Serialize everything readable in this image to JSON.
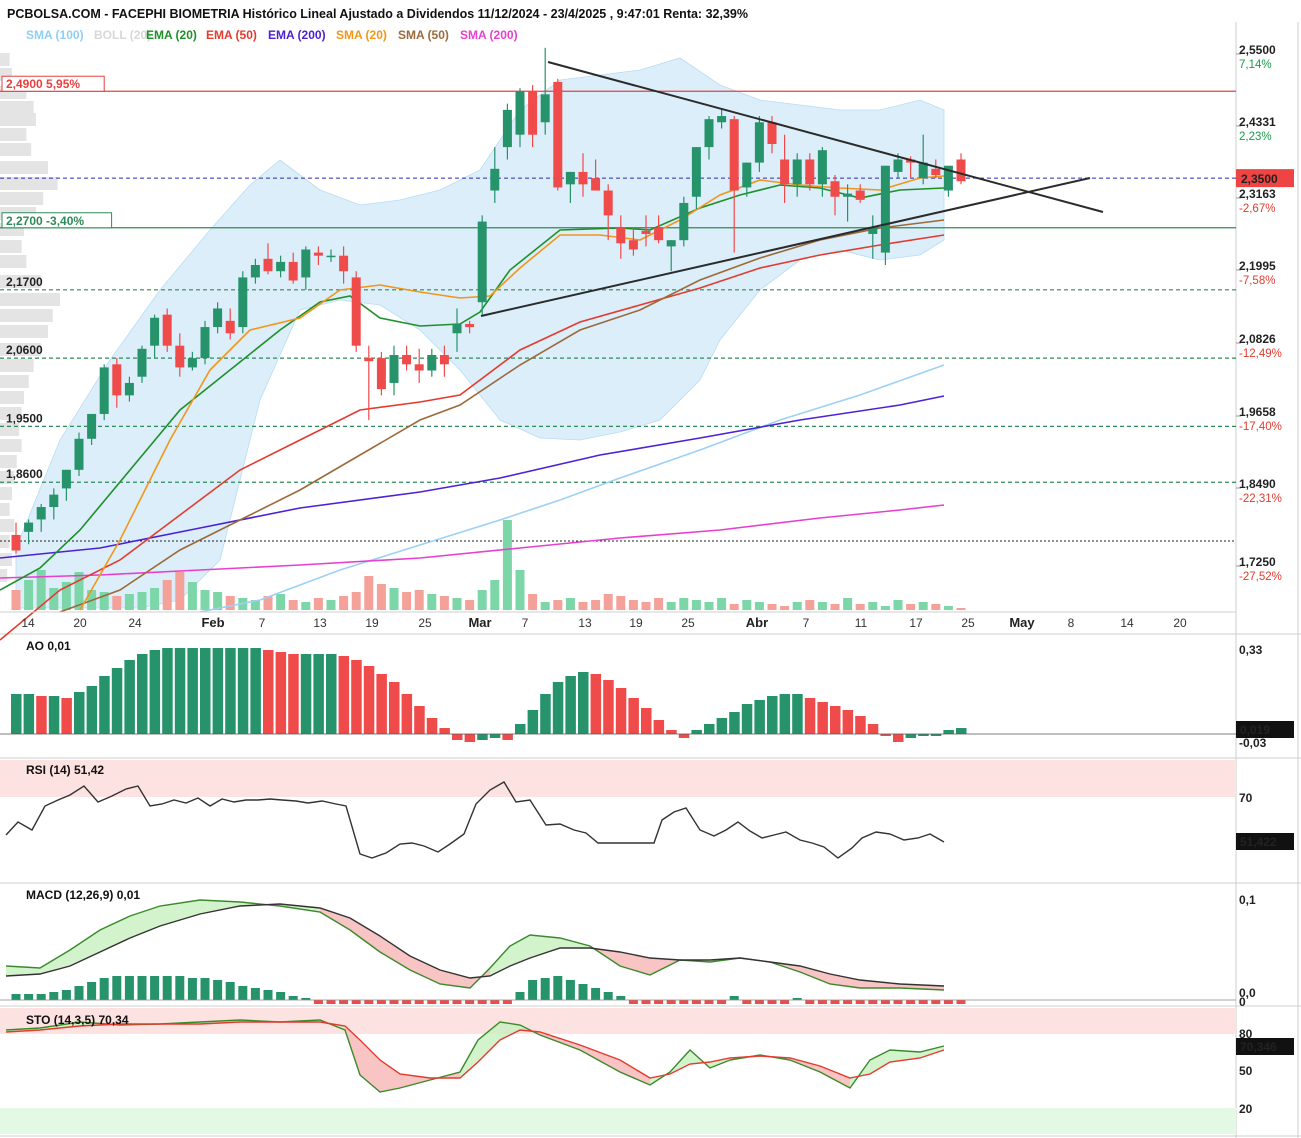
{
  "header": {
    "title": "PCBOLSA.COM - FACEPHI BIOMETRIA Histórico Lineal Ajustado a Dividendos 11/12/2024 - 23/4/2025 , 9:47:01 Renta: 32,39%"
  },
  "legend": [
    {
      "label": "SMA (100)",
      "color": "#8fcff5"
    },
    {
      "label": "BOLL (20)",
      "color": "#d8d8d8"
    },
    {
      "label": "EMA (20)",
      "color": "#1f8f2a"
    },
    {
      "label": "EMA (50)",
      "color": "#e33b2e"
    },
    {
      "label": "EMA (200)",
      "color": "#4b22d6"
    },
    {
      "label": "SMA (20)",
      "color": "#f2961a"
    },
    {
      "label": "SMA (50)",
      "color": "#9c6a3a"
    },
    {
      "label": "SMA (200)",
      "color": "#e83fd0"
    }
  ],
  "price_axis": {
    "ticks": [
      {
        "value": "2,5500",
        "pct": "7,14%",
        "pct_color": "#1a9a4a"
      },
      {
        "value": "2,4331",
        "pct": "2,23%",
        "pct_color": "#1a9a4a"
      },
      {
        "value": "2,3163",
        "pct": "-2,67%",
        "pct_color": "#e33b2e"
      },
      {
        "value": "2,1995",
        "pct": "-7,58%",
        "pct_color": "#e33b2e"
      },
      {
        "value": "2,0826",
        "pct": "-12,49%",
        "pct_color": "#e33b2e"
      },
      {
        "value": "1,9658",
        "pct": "-17,40%",
        "pct_color": "#e33b2e"
      },
      {
        "value": "1,8490",
        "pct": "-22,31%",
        "pct_color": "#e33b2e"
      },
      {
        "value": "1,7250",
        "pct": "-27,52%",
        "pct_color": "#e33b2e"
      }
    ],
    "current_price": "2,3500"
  },
  "levels": [
    {
      "label": "2,4900  5,95%",
      "price": 2.49,
      "color": "#e84040",
      "style": "solid",
      "boxed": true
    },
    {
      "label": "2,2700  -3,40%",
      "price": 2.27,
      "color": "#2e8b57",
      "style": "solid",
      "boxed": true
    },
    {
      "label": "2,1700",
      "price": 2.17,
      "color": "#2e8b57",
      "style": "dashed"
    },
    {
      "label": "2,0600",
      "price": 2.06,
      "color": "#2e8b57",
      "style": "dashed"
    },
    {
      "label": "1,9500",
      "price": 1.95,
      "color": "#2e8b57",
      "style": "dashed"
    },
    {
      "label": "1,8600",
      "price": 1.86,
      "color": "#2e8b57",
      "style": "dashed"
    }
  ],
  "x_axis": {
    "labels": [
      {
        "text": "14",
        "bold": false
      },
      {
        "text": "20",
        "bold": false
      },
      {
        "text": "24",
        "bold": false
      },
      {
        "text": "Feb",
        "bold": true
      },
      {
        "text": "7",
        "bold": false
      },
      {
        "text": "13",
        "bold": false
      },
      {
        "text": "19",
        "bold": false
      },
      {
        "text": "25",
        "bold": false
      },
      {
        "text": "Mar",
        "bold": true
      },
      {
        "text": "7",
        "bold": false
      },
      {
        "text": "13",
        "bold": false
      },
      {
        "text": "19",
        "bold": false
      },
      {
        "text": "25",
        "bold": false
      },
      {
        "text": "Abr",
        "bold": true
      },
      {
        "text": "7",
        "bold": false
      },
      {
        "text": "11",
        "bold": false
      },
      {
        "text": "17",
        "bold": false
      },
      {
        "text": "25",
        "bold": false
      },
      {
        "text": "May",
        "bold": true
      },
      {
        "text": "8",
        "bold": false
      },
      {
        "text": "14",
        "bold": false
      },
      {
        "text": "20",
        "bold": false
      }
    ]
  },
  "panels": {
    "ao": {
      "label": "AO",
      "value": "0,01",
      "ticks": [
        "0,33",
        "-0,03"
      ],
      "current": "0,019"
    },
    "rsi": {
      "label": "RSI (14)",
      "value": "51,42",
      "ticks": [
        "70"
      ],
      "current": "51,422"
    },
    "macd": {
      "label": "MACD (12,26,9)",
      "value": "0,01",
      "ticks": [
        "0,1",
        "0,0",
        "0"
      ]
    },
    "sto": {
      "label": "STO (14,3,5)",
      "value": "70,34",
      "ticks": [
        "80",
        "50",
        "20"
      ],
      "current": "70,346"
    }
  },
  "chart_data": {
    "type": "candlestick",
    "title": "PCBOLSA.COM - FACEPHI BIOMETRIA Histórico Lineal Ajustado a Dividendos 11/12/2024 - 23/4/2025 , 9:47:01 Renta: 32,39%",
    "ylim": [
      1.7,
      2.58
    ],
    "ohlc": [
      [
        1.775,
        1.795,
        1.745,
        1.75
      ],
      [
        1.78,
        1.8,
        1.76,
        1.795
      ],
      [
        1.8,
        1.825,
        1.78,
        1.82
      ],
      [
        1.82,
        1.85,
        1.8,
        1.84
      ],
      [
        1.85,
        1.88,
        1.83,
        1.88
      ],
      [
        1.88,
        1.94,
        1.87,
        1.93
      ],
      [
        1.93,
        1.97,
        1.92,
        1.97
      ],
      [
        1.97,
        2.05,
        1.96,
        2.045
      ],
      [
        2.05,
        2.06,
        1.98,
        2.0
      ],
      [
        2.0,
        2.03,
        1.99,
        2.02
      ],
      [
        2.03,
        2.08,
        2.02,
        2.075
      ],
      [
        2.08,
        2.13,
        2.06,
        2.125
      ],
      [
        2.13,
        2.14,
        2.07,
        2.08
      ],
      [
        2.08,
        2.1,
        2.03,
        2.045
      ],
      [
        2.045,
        2.07,
        2.04,
        2.06
      ],
      [
        2.06,
        2.12,
        2.05,
        2.11
      ],
      [
        2.11,
        2.15,
        2.1,
        2.14
      ],
      [
        2.12,
        2.14,
        2.09,
        2.1
      ],
      [
        2.11,
        2.2,
        2.1,
        2.19
      ],
      [
        2.19,
        2.22,
        2.18,
        2.21
      ],
      [
        2.22,
        2.245,
        2.195,
        2.2
      ],
      [
        2.2,
        2.225,
        2.19,
        2.215
      ],
      [
        2.215,
        2.23,
        2.18,
        2.185
      ],
      [
        2.19,
        2.24,
        2.17,
        2.235
      ],
      [
        2.23,
        2.24,
        2.21,
        2.225
      ],
      [
        2.225,
        2.235,
        2.215,
        2.225
      ],
      [
        2.225,
        2.24,
        2.18,
        2.2
      ],
      [
        2.19,
        2.2,
        2.07,
        2.08
      ],
      [
        2.06,
        2.08,
        1.96,
        2.055
      ],
      [
        2.06,
        2.07,
        2.0,
        2.01
      ],
      [
        2.02,
        2.08,
        2.0,
        2.065
      ],
      [
        2.065,
        2.08,
        2.04,
        2.05
      ],
      [
        2.05,
        2.075,
        2.02,
        2.04
      ],
      [
        2.04,
        2.075,
        2.03,
        2.065
      ],
      [
        2.065,
        2.08,
        2.03,
        2.05
      ],
      [
        2.1,
        2.14,
        2.07,
        2.115
      ],
      [
        2.115,
        2.12,
        2.1,
        2.11
      ],
      [
        2.15,
        2.29,
        2.13,
        2.28
      ],
      [
        2.33,
        2.4,
        2.31,
        2.365
      ],
      [
        2.4,
        2.47,
        2.38,
        2.46
      ],
      [
        2.42,
        2.495,
        2.4,
        2.49
      ],
      [
        2.49,
        2.5,
        2.4,
        2.42
      ],
      [
        2.44,
        2.56,
        2.42,
        2.485
      ],
      [
        2.505,
        2.51,
        2.33,
        2.335
      ],
      [
        2.34,
        2.36,
        2.31,
        2.36
      ],
      [
        2.36,
        2.39,
        2.32,
        2.34
      ],
      [
        2.35,
        2.38,
        2.33,
        2.33
      ],
      [
        2.33,
        2.34,
        2.25,
        2.29
      ],
      [
        2.27,
        2.29,
        2.22,
        2.245
      ],
      [
        2.25,
        2.27,
        2.225,
        2.235
      ],
      [
        2.265,
        2.29,
        2.24,
        2.26
      ],
      [
        2.27,
        2.29,
        2.245,
        2.25
      ],
      [
        2.24,
        2.25,
        2.2,
        2.25
      ],
      [
        2.25,
        2.32,
        2.24,
        2.31
      ],
      [
        2.32,
        2.4,
        2.3,
        2.4
      ],
      [
        2.4,
        2.45,
        2.38,
        2.445
      ],
      [
        2.44,
        2.46,
        2.43,
        2.45
      ],
      [
        2.445,
        2.45,
        2.23,
        2.33
      ],
      [
        2.335,
        2.375,
        2.32,
        2.375
      ],
      [
        2.375,
        2.45,
        2.36,
        2.44
      ],
      [
        2.44,
        2.45,
        2.39,
        2.405
      ],
      [
        2.38,
        2.42,
        2.31,
        2.34
      ],
      [
        2.34,
        2.39,
        2.32,
        2.38
      ],
      [
        2.38,
        2.39,
        2.33,
        2.34
      ],
      [
        2.34,
        2.4,
        2.32,
        2.395
      ],
      [
        2.345,
        2.355,
        2.29,
        2.32
      ],
      [
        2.32,
        2.34,
        2.28,
        2.325
      ],
      [
        2.33,
        2.34,
        2.31,
        2.315
      ],
      [
        2.26,
        2.29,
        2.22,
        2.27
      ],
      [
        2.23,
        2.35,
        2.21,
        2.37
      ],
      [
        2.36,
        2.39,
        2.35,
        2.38
      ],
      [
        2.38,
        2.385,
        2.35,
        2.375
      ],
      [
        2.35,
        2.42,
        2.34,
        2.375
      ],
      [
        2.365,
        2.38,
        2.35,
        2.355
      ],
      [
        2.33,
        2.36,
        2.32,
        2.37
      ],
      [
        2.38,
        2.39,
        2.34,
        2.345
      ]
    ],
    "current": 2.35
  }
}
